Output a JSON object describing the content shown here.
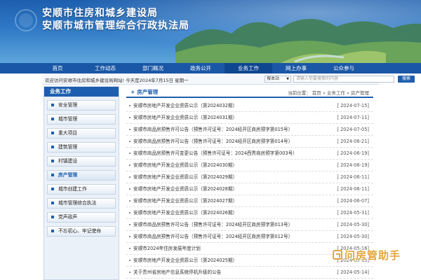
{
  "header": {
    "title_line1": "安顺市住房和城乡建设局",
    "title_line2": "安顺市城市管理综合行政执法局"
  },
  "nav": {
    "items": [
      {
        "label": "首页",
        "active": false
      },
      {
        "label": "工作动态",
        "active": false
      },
      {
        "label": "部门概况",
        "active": false
      },
      {
        "label": "政务公开",
        "active": false
      },
      {
        "label": "业务工作",
        "active": true
      },
      {
        "label": "网上办事",
        "active": false
      },
      {
        "label": "公众参与",
        "active": false
      }
    ]
  },
  "infobar": {
    "welcome": "欢迎访问安顺市住房和城乡建设局网站! 今天是2024年7月15日 星期一",
    "search_scope": "搜本站",
    "search_placeholder": "请输入你要搜索的内容",
    "search_button": "搜索"
  },
  "sidebar": {
    "title": "业务工作",
    "items": [
      {
        "label": "安全管理",
        "active": false
      },
      {
        "label": "城市管理",
        "active": false
      },
      {
        "label": "重大项目",
        "active": false
      },
      {
        "label": "建筑管理",
        "active": false
      },
      {
        "label": "村镇建设",
        "active": false
      },
      {
        "label": "房产管理",
        "active": true
      },
      {
        "label": "城市创建工作",
        "active": false
      },
      {
        "label": "城市管理综合执法",
        "active": false
      },
      {
        "label": "党声政声",
        "active": false
      },
      {
        "label": "不忘初心、牢记使命",
        "active": false
      }
    ]
  },
  "main": {
    "title": "房产管理",
    "breadcrumb": "当前位置：  首页 » 业务工作 » 房产管理",
    "items": [
      {
        "title": "安顺市房地产开发企业资质公示（第2024032期）",
        "date": "[ 2024-07-15]"
      },
      {
        "title": "安顺市房地产开发企业资质公示（第2024031期）",
        "date": "[ 2024-07-11]"
      },
      {
        "title": "安顺市商品房预售许可公告（预售许可证号：2024经开区商房预字第015号）",
        "date": "[ 2024-07-05]"
      },
      {
        "title": "安顺市商品房预售许可公告（预售许可证号：2024经开区商房预字第014号）",
        "date": "[ 2024-06-21]"
      },
      {
        "title": "安顺市商品房预售许可变更公告（预售许可证号：2024西秀商房预字第003号）",
        "date": "[ 2024-06-19]"
      },
      {
        "title": "安顺市房地产开发企业资质公示（第2024030期）",
        "date": "[ 2024-06-19]"
      },
      {
        "title": "安顺市房地产开发企业资质公示（第2024029期）",
        "date": "[ 2024-06-11]"
      },
      {
        "title": "安顺市房地产开发企业资质公示（第2024028期）",
        "date": "[ 2024-06-11]"
      },
      {
        "title": "安顺市房地产开发企业资质公示（第2024027期）",
        "date": "[ 2024-06-07]"
      },
      {
        "title": "安顺市房地产开发企业资质公示（第2024026期）",
        "date": "[ 2024-05-31]"
      },
      {
        "title": "安顺市商品房预售许可公告（预售许可证号：2024经开区商房预字第013号）",
        "date": "[ 2024-05-30]"
      },
      {
        "title": "安顺市商品房预售许可公告（预售许可证号：2024经开区商房预字第012号）",
        "date": "[ 2024-05-30]"
      },
      {
        "title": "安顺市2024年住房发展年度计划",
        "date": "[ 2024-05-16]"
      },
      {
        "title": "安顺市房地产开发企业资质公示（第2024025期）",
        "date": "[ 2024-05-15]"
      },
      {
        "title": "关于贵州省房地产信息系统停机升级的公告",
        "date": "[ 2024-05-14]"
      }
    ]
  },
  "watermark": {
    "text": "问房管助手"
  },
  "colors": {
    "primary": "#1d5fae",
    "nav_bg": "#1a57a6",
    "sidebar_bg": "#eaf1f9",
    "watermark": "#e4a53a"
  }
}
